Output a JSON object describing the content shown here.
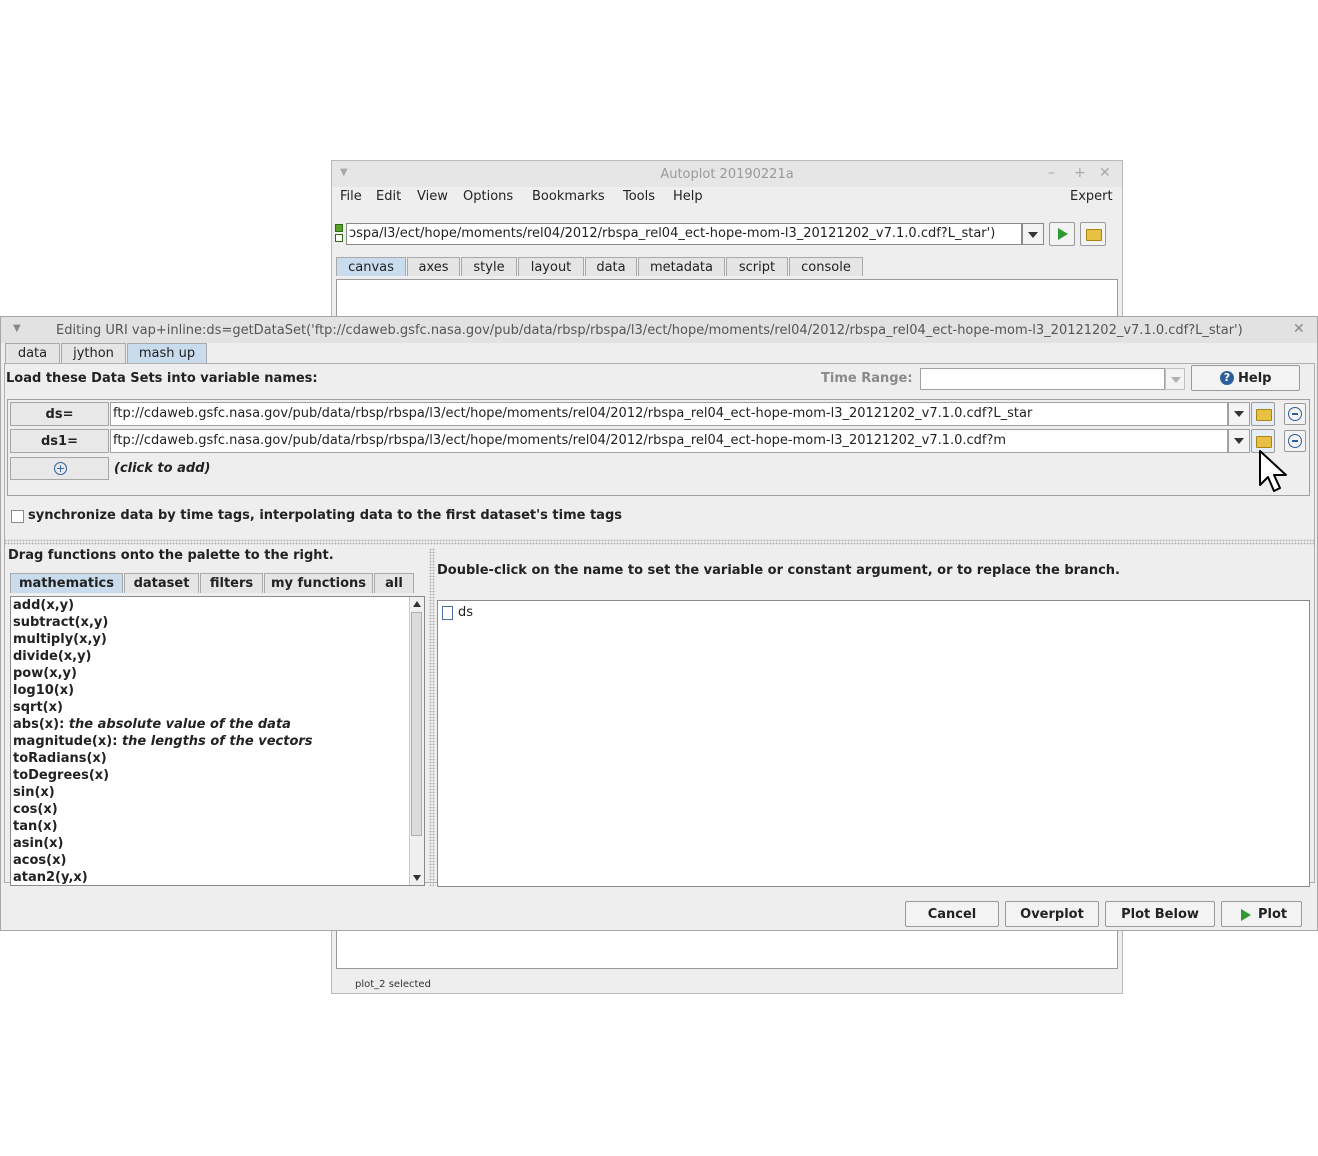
{
  "main_window": {
    "title": "Autoplot 20190221a",
    "menu": [
      "File",
      "Edit",
      "View",
      "Options",
      "Bookmarks",
      "Tools",
      "Help"
    ],
    "expert_label": "Expert",
    "uri_value": "ɔspa/l3/ect/hope/moments/rel04/2012/rbspa_rel04_ect-hope-mom-l3_20121202_v7.1.0.cdf?L_star')",
    "tabs": [
      "canvas",
      "axes",
      "style",
      "layout",
      "data",
      "metadata",
      "script",
      "console"
    ],
    "status": "plot_2 selected"
  },
  "dialog": {
    "title": "Editing URI vap+inline:ds=getDataSet('ftp://cdaweb.gsfc.nasa.gov/pub/data/rbsp/rbspa/l3/ect/hope/moments/rel04/2012/rbspa_rel04_ect-hope-mom-l3_20121202_v7.1.0.cdf?L_star')",
    "tabs": [
      "data",
      "jython",
      "mash up"
    ],
    "load_label": "Load these Data Sets into variable names:",
    "time_range_label": "Time Range:",
    "time_range_value": "",
    "help_label": "Help",
    "variables": [
      {
        "name": "ds=",
        "uri": "ftp://cdaweb.gsfc.nasa.gov/pub/data/rbsp/rbspa/l3/ect/hope/moments/rel04/2012/rbspa_rel04_ect-hope-mom-l3_20121202_v7.1.0.cdf?L_star"
      },
      {
        "name": "ds1=",
        "uri": "ftp://cdaweb.gsfc.nasa.gov/pub/data/rbsp/rbspa/l3/ect/hope/moments/rel04/2012/rbspa_rel04_ect-hope-mom-l3_20121202_v7.1.0.cdf?m"
      }
    ],
    "add_label": "(click to add)",
    "sync_label": "synchronize data by time tags, interpolating data to the first dataset's time tags",
    "sync_checked": false,
    "drag_label": "Drag functions onto the palette to the right.",
    "function_tabs": [
      "mathematics",
      "dataset",
      "filters",
      "my functions",
      "all"
    ],
    "functions": [
      {
        "name": "add(x,y)",
        "desc": ""
      },
      {
        "name": "subtract(x,y)",
        "desc": ""
      },
      {
        "name": "multiply(x,y)",
        "desc": ""
      },
      {
        "name": "divide(x,y)",
        "desc": ""
      },
      {
        "name": "pow(x,y)",
        "desc": ""
      },
      {
        "name": "log10(x)",
        "desc": ""
      },
      {
        "name": "sqrt(x)",
        "desc": ""
      },
      {
        "name": "abs(x):",
        "desc": "the absolute value of the data"
      },
      {
        "name": "magnitude(x):",
        "desc": "the lengths of the vectors"
      },
      {
        "name": "toRadians(x)",
        "desc": ""
      },
      {
        "name": "toDegrees(x)",
        "desc": ""
      },
      {
        "name": "sin(x)",
        "desc": ""
      },
      {
        "name": "cos(x)",
        "desc": ""
      },
      {
        "name": "tan(x)",
        "desc": ""
      },
      {
        "name": "asin(x)",
        "desc": ""
      },
      {
        "name": "acos(x)",
        "desc": ""
      },
      {
        "name": "atan2(y,x)",
        "desc": ""
      }
    ],
    "palette_label": "Double-click on the name to set the variable or constant argument, or to replace the branch.",
    "tree_root": "ds",
    "buttons": {
      "cancel": "Cancel",
      "overplot": "Overplot",
      "plot_below": "Plot Below",
      "plot": "Plot"
    }
  },
  "colors": {
    "selected_tab": "#c9dced",
    "play_green": "#2f9a2f",
    "accent_blue": "#2e5e9e"
  }
}
